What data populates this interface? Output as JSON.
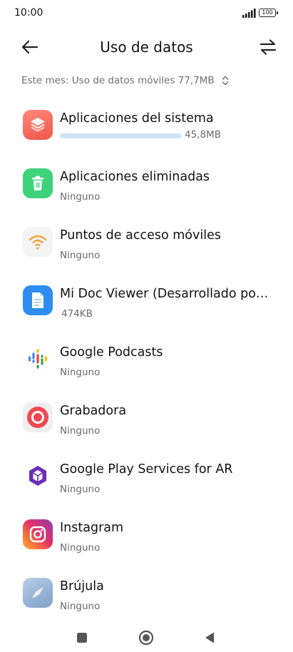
{
  "status": {
    "time": "10:00",
    "battery": "100"
  },
  "header": {
    "title": "Uso de datos"
  },
  "period": {
    "label": "Este mes: Uso de datos móviles 77,7MB"
  },
  "apps": [
    {
      "name": "Aplicaciones del sistema",
      "usage": "45,8MB",
      "usage_fraction": 1.0,
      "icon": "layers-icon"
    },
    {
      "name": "Aplicaciones eliminadas",
      "usage": "Ninguno",
      "icon": "trash-icon"
    },
    {
      "name": "Puntos de acceso móviles",
      "usage": "Ninguno",
      "icon": "wifi-hotspot-icon"
    },
    {
      "name": "Mi Doc Viewer (Desarrollado por…",
      "usage": "474KB",
      "icon": "document-icon"
    },
    {
      "name": "Google Podcasts",
      "usage": "Ninguno",
      "icon": "podcasts-icon"
    },
    {
      "name": "Grabadora",
      "usage": "Ninguno",
      "icon": "recorder-icon"
    },
    {
      "name": "Google Play Services for AR",
      "usage": "Ninguno",
      "icon": "arcore-icon"
    },
    {
      "name": "Instagram",
      "usage": "Ninguno",
      "icon": "instagram-icon"
    },
    {
      "name": "Brújula",
      "usage": "Ninguno",
      "icon": "compass-icon"
    }
  ],
  "colors": {
    "accent_bar": "#cfe2f7",
    "secondary_text": "#6a6a6a"
  }
}
